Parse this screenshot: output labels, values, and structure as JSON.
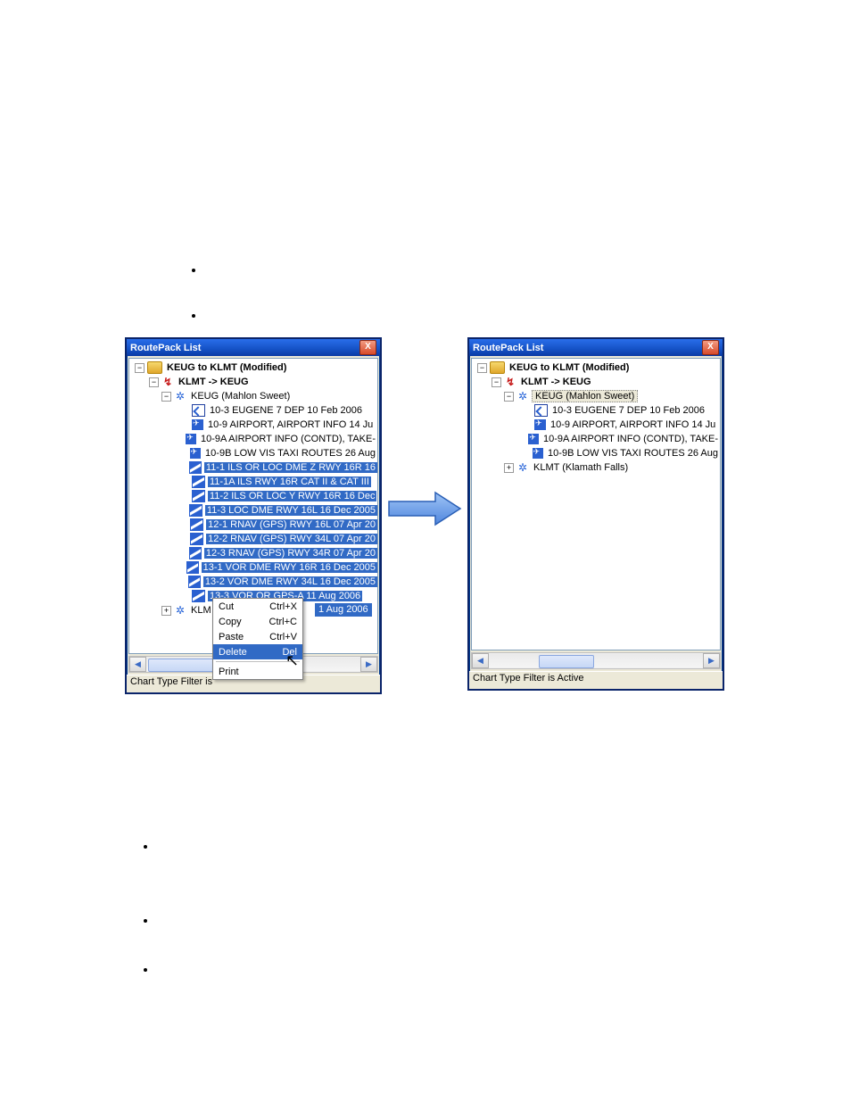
{
  "bullets_top_count": 2,
  "bullets_bottom_count": 3,
  "left_window": {
    "title": "RoutePack List",
    "close_label": "X",
    "status": "Chart Type Filter is",
    "scroll_left_glyph": "◀",
    "scroll_right_glyph": "▶",
    "tree": {
      "root": "KEUG to KLMT (Modified)",
      "route": "KLMT -> KEUG",
      "airport_a": "KEUG (Mahlon Sweet)",
      "charts_a": [
        {
          "ico": "dep",
          "label": "10-3   EUGENE 7 DEP   10 Feb 2006",
          "sel": false
        },
        {
          "ico": "apt",
          "label": "10-9   AIRPORT, AIRPORT INFO   14 Ju",
          "sel": false
        },
        {
          "ico": "apt",
          "label": "10-9A  AIRPORT INFO (CONTD), TAKE-",
          "sel": false
        },
        {
          "ico": "apt",
          "label": "10-9B  LOW VIS TAXI ROUTES   26 Aug",
          "sel": false
        },
        {
          "ico": "chart",
          "label": "11-1   ILS OR LOC DME Z RWY 16R   16",
          "sel": true
        },
        {
          "ico": "chart",
          "label": "11-1A  ILS RWY 16R CAT II & CAT III",
          "sel": true
        },
        {
          "ico": "chart",
          "label": "11-2   ILS OR LOC Y RWY 16R   16 Dec",
          "sel": true
        },
        {
          "ico": "chart",
          "label": "11-3   LOC DME RWY 16L   16 Dec 2005",
          "sel": true
        },
        {
          "ico": "chart",
          "label": "12-1   RNAV (GPS) RWY 16L   07 Apr 20",
          "sel": true
        },
        {
          "ico": "chart",
          "label": "12-2   RNAV (GPS) RWY 34L   07 Apr 20",
          "sel": true
        },
        {
          "ico": "chart",
          "label": "12-3   RNAV (GPS) RWY 34R   07 Apr 20",
          "sel": true
        },
        {
          "ico": "chart",
          "label": "13-1   VOR DME RWY 16R   16 Dec 2005",
          "sel": true
        },
        {
          "ico": "chart",
          "label": "13-2   VOR DME RWY 34L   16 Dec 2005",
          "sel": true
        },
        {
          "ico": "chart",
          "label": "13-3   VOR OR GPS-A   11 Aug 2006",
          "sel": true
        }
      ],
      "extra_date_tag": "1 Aug 2006",
      "airport_b": "KLM"
    },
    "context_menu": {
      "items": [
        {
          "label": "Cut",
          "shortcut": "Ctrl+X",
          "hl": false
        },
        {
          "label": "Copy",
          "shortcut": "Ctrl+C",
          "hl": false
        },
        {
          "label": "Paste",
          "shortcut": "Ctrl+V",
          "hl": false
        },
        {
          "label": "Delete",
          "shortcut": "Del",
          "hl": true
        }
      ],
      "below_sep": [
        {
          "label": "Print",
          "shortcut": "",
          "hl": false
        }
      ]
    }
  },
  "right_window": {
    "title": "RoutePack List",
    "close_label": "X",
    "status": "Chart Type Filter is Active",
    "scroll_left_glyph": "◀",
    "scroll_right_glyph": "▶",
    "tree": {
      "root": "KEUG to KLMT (Modified)",
      "route": "KLMT -> KEUG",
      "airport_a": "KEUG (Mahlon Sweet)",
      "airport_a_selected": true,
      "charts_a": [
        {
          "ico": "dep",
          "label": "10-3   EUGENE 7 DEP   10 Feb 2006"
        },
        {
          "ico": "apt",
          "label": "10-9   AIRPORT, AIRPORT INFO   14 Ju"
        },
        {
          "ico": "apt",
          "label": "10-9A  AIRPORT INFO (CONTD), TAKE-"
        },
        {
          "ico": "apt",
          "label": "10-9B  LOW VIS TAXI ROUTES   26 Aug"
        }
      ],
      "airport_b": "KLMT (Klamath Falls)"
    }
  }
}
